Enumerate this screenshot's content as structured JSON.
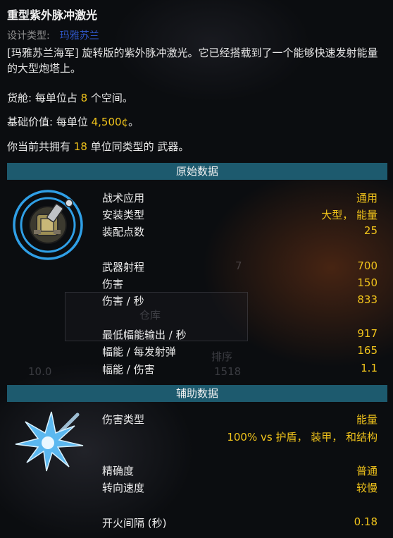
{
  "weapon": {
    "name": "重型紫外脉冲激光",
    "design_label": "设计类型:",
    "design_value": "玛雅苏兰",
    "description": "[玛雅苏兰海军] 旋转版的紫外脉冲激光。它已经搭载到了一个能够快速发射能量的大型炮塔上。",
    "cargo_prefix": "货舱:  每单位占 ",
    "cargo_value": "8",
    "cargo_suffix": " 个空间。",
    "base_value_prefix": "基础价值:  每单位 ",
    "base_value": "4,500¢",
    "base_value_suffix": "。",
    "owned_prefix": "你当前共拥有 ",
    "owned_value": "18",
    "owned_suffix": " 单位同类型的 武器。"
  },
  "sections": {
    "primary_title": "原始数据",
    "secondary_title": "辅助数据"
  },
  "primary_stats": [
    {
      "label": "战术应用",
      "value": "通用"
    },
    {
      "label": "安装类型",
      "value": "大型， 能量"
    },
    {
      "label": "装配点数",
      "value": "25"
    },
    {
      "label": "武器射程",
      "value": "700"
    },
    {
      "label": "伤害",
      "value": "150"
    },
    {
      "label": "伤害 / 秒",
      "value": "833"
    },
    {
      "label": "最低幅能输出 / 秒",
      "value": "917"
    },
    {
      "label": "幅能 / 每发射弹",
      "value": "165"
    },
    {
      "label": "幅能 / 伤害",
      "value": "1.1"
    }
  ],
  "secondary_stats": [
    {
      "label": "伤害类型",
      "value": "能量"
    },
    {
      "label": "",
      "value": "100% vs 护盾， 装甲， 和结构"
    },
    {
      "label": "精确度",
      "value": "普通"
    },
    {
      "label": "转向速度",
      "value": "较慢"
    },
    {
      "label": "开火间隔 (秒)",
      "value": "0.18"
    }
  ],
  "background_ghosts": {
    "storage": "仓库",
    "sort": "排序",
    "num1": "10.0",
    "num2": "1518",
    "num3": "7"
  },
  "colors": {
    "section_bg": "#1d5a6e",
    "highlight": "#f0c31b",
    "design_link": "#2f56c8"
  },
  "icons": {
    "weapon_turret": "laser-turret-icon",
    "projectile": "energy-burst-icon"
  }
}
